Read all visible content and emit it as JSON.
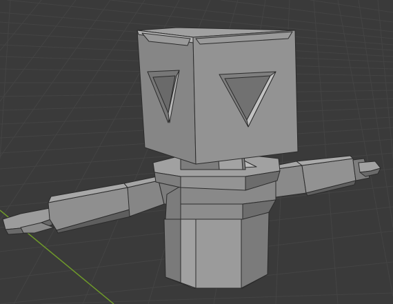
{
  "viewport": {
    "view": "3D Viewport",
    "background_color": "#3a3a3a",
    "grid_color": "#454545",
    "y_axis_color": "#6f9a2a",
    "mesh_face_color": "#8c8c8c",
    "mesh_dark_color": "#5c5c5c",
    "mesh_light_color": "#a2a2a2",
    "edge_color": "#2b2b2b"
  },
  "scene_objects": [
    {
      "name": "robot-mesh",
      "parts": [
        "head",
        "neck",
        "body",
        "left-arm",
        "right-arm"
      ]
    }
  ]
}
